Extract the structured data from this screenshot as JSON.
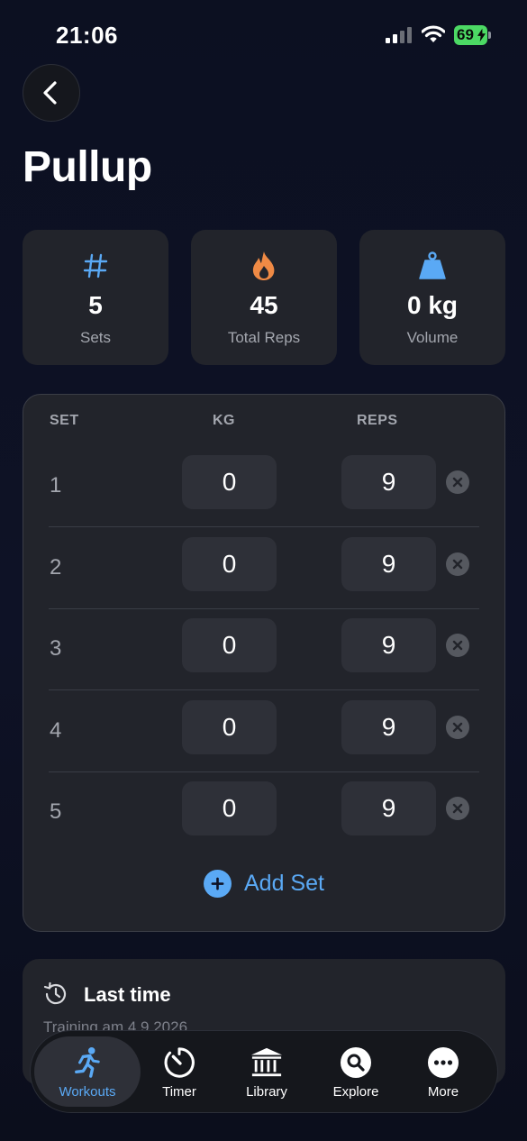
{
  "status_bar": {
    "time": "21:06",
    "battery": "69"
  },
  "page": {
    "title": "Pullup"
  },
  "stats": [
    {
      "value": "5",
      "label": "Sets",
      "icon": "hash-icon",
      "color": "#5aa9f5"
    },
    {
      "value": "45",
      "label": "Total Reps",
      "icon": "flame-icon",
      "color": "#ef8a45"
    },
    {
      "value": "0 kg",
      "label": "Volume",
      "icon": "weight-icon",
      "color": "#5aa9f5"
    }
  ],
  "sets_table": {
    "headers": {
      "set": "SET",
      "kg": "KG",
      "reps": "REPS"
    },
    "rows": [
      {
        "set": "1",
        "kg": "0",
        "reps": "9"
      },
      {
        "set": "2",
        "kg": "0",
        "reps": "9"
      },
      {
        "set": "3",
        "kg": "0",
        "reps": "9"
      },
      {
        "set": "4",
        "kg": "0",
        "reps": "9"
      },
      {
        "set": "5",
        "kg": "0",
        "reps": "9"
      }
    ],
    "add_label": "Add Set"
  },
  "last_time": {
    "title": "Last time",
    "subtitle": "Training am 4.9.2026"
  },
  "tabs": [
    {
      "label": "Workouts",
      "icon": "runner-icon",
      "active": true
    },
    {
      "label": "Timer",
      "icon": "timer-icon",
      "active": false
    },
    {
      "label": "Library",
      "icon": "library-icon",
      "active": false
    },
    {
      "label": "Explore",
      "icon": "search-icon",
      "active": false
    },
    {
      "label": "More",
      "icon": "more-icon",
      "active": false
    }
  ],
  "colors": {
    "accent": "#5aa9f5",
    "card": "#22242b",
    "background": "#0d1020"
  }
}
